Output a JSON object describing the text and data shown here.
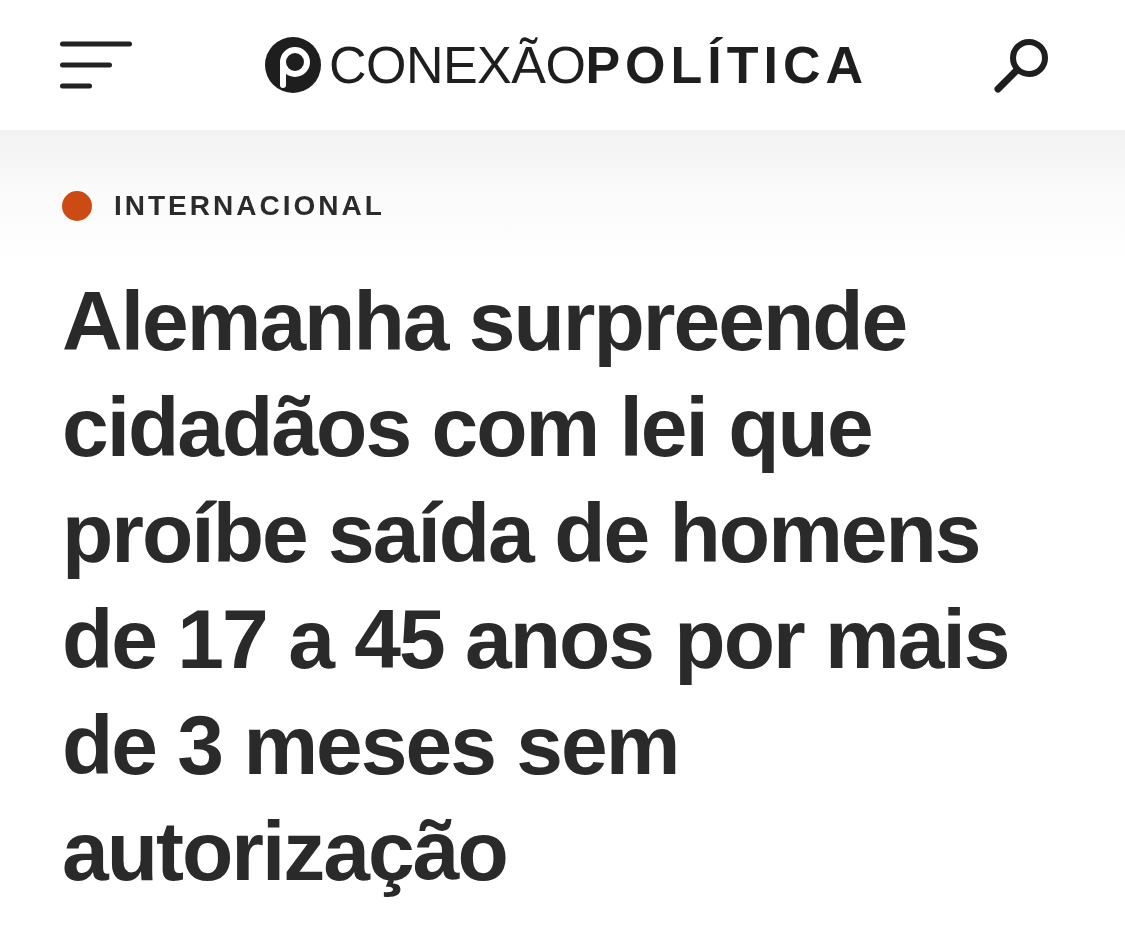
{
  "header": {
    "logo": "CONEXÃO**POLÍTICA**"
  },
  "article": {
    "category": "INTERNACIONAL",
    "headline": "Alemanha surpreende cidadãos com lei que proíbe saída de homens de 17 a 45 anos por mais de 3 meses sem autorização"
  }
}
